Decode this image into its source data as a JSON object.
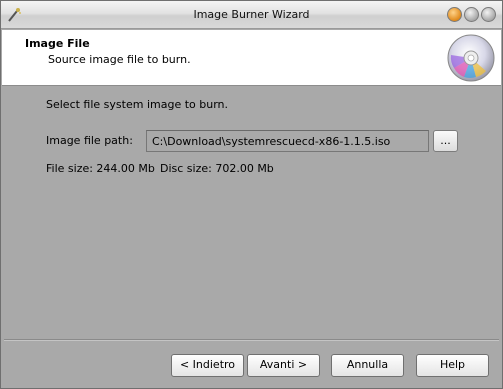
{
  "window": {
    "title": "Image Burner Wizard",
    "icons": {
      "app": "wand-icon",
      "minimize": "minimize-icon",
      "maximize": "maximize-icon",
      "close": "close-icon"
    }
  },
  "header": {
    "title": "Image File",
    "subtitle": "Source image file to burn.",
    "icon": "disc-icon"
  },
  "content": {
    "prompt": "Select file system image to burn.",
    "path_label": "Image file path:",
    "path_value": "C:\\Download\\systemrescuecd-x86-1.1.5.iso",
    "browse_label": "...",
    "file_size": "File size: 244.00 Mb",
    "disc_size": "Disc size: 702.00 Mb"
  },
  "buttons": {
    "back": "< Indietro",
    "next": "Avanti >",
    "cancel": "Annulla",
    "help": "Help"
  },
  "colors": {
    "background": "#a9a9a9",
    "header": "#ffffff"
  }
}
